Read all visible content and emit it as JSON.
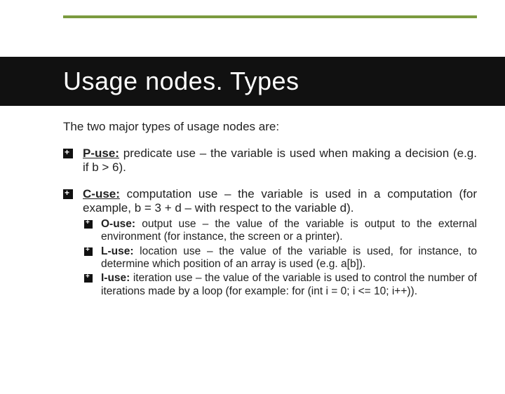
{
  "title": "Usage nodes. Types",
  "intro": "The two major types of usage nodes are:",
  "items": [
    {
      "term": "P-use:",
      "text": " predicate use – the variable is used when making a decision (e.g. if b > 6)."
    },
    {
      "term": "C-use:",
      "text": " computation use – the variable is used in a computation (for example, b = 3 + d – with respect to the variable d).",
      "subitems": [
        {
          "term": "O-use:",
          "text": " output use – the value of the variable is output to the external environment (for instance, the screen or a printer)."
        },
        {
          "term": "L-use:",
          "text": " location use – the value of the variable is used, for instance, to determine which position of an array is used (e.g. a[b])."
        },
        {
          "term": "I-use:",
          "text": " iteration use – the value of the variable is used to control the number of iterations made by a loop (for example: for (int i = 0; i <= 10; i++))."
        }
      ]
    }
  ]
}
